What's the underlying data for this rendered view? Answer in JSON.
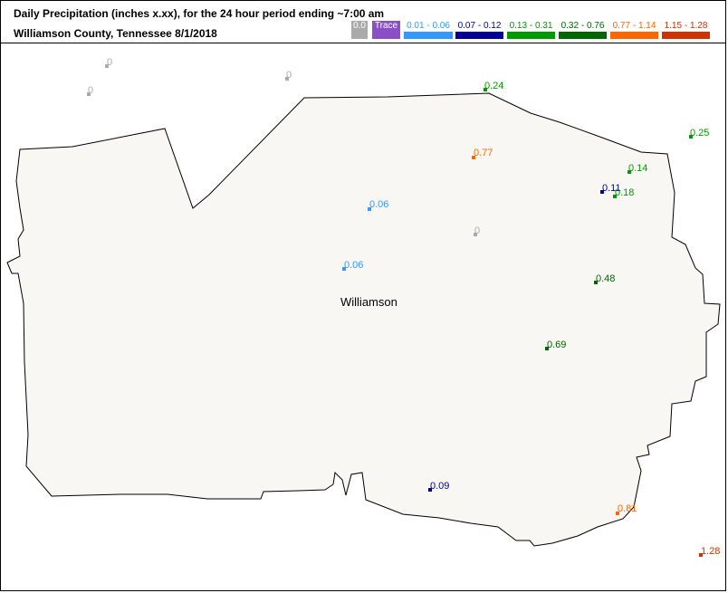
{
  "header": {
    "title": "Daily Precipitation (inches  x.xx),  for the 24 hour period ending ~7:00 am",
    "subtitle": "Williamson County, Tennessee  8/1/2018"
  },
  "legend": [
    {
      "label": "0.0",
      "color": "#aaaaaa"
    },
    {
      "label": "Trace",
      "color": "#8a4fc7"
    },
    {
      "label": "0.01 - 0.06",
      "color": "#3399ff"
    },
    {
      "label": "0.07 - 0.12",
      "color": "#000099"
    },
    {
      "label": "0.13 - 0.31",
      "color": "#009900"
    },
    {
      "label": "0.32 - 0.76",
      "color": "#006600"
    },
    {
      "label": "0.77 - 1.14",
      "color": "#ff6600"
    },
    {
      "label": "1.15 - 1.28",
      "color": "#cc3300"
    }
  ],
  "map": {
    "county_name": "Williamson",
    "fill_color": "#f8f7f3",
    "stations": [
      {
        "value": "0",
        "color": "#aaaaaa"
      },
      {
        "value": "0",
        "color": "#aaaaaa"
      },
      {
        "value": "0",
        "color": "#aaaaaa"
      },
      {
        "value": "0.24",
        "color": "#009900"
      },
      {
        "value": "0.25",
        "color": "#009900"
      },
      {
        "value": "0.77",
        "color": "#ff6600"
      },
      {
        "value": "0.14",
        "color": "#009900"
      },
      {
        "value": "0.11",
        "color": "#000099"
      },
      {
        "value": "0.18",
        "color": "#009900"
      },
      {
        "value": "0.06",
        "color": "#3399ff"
      },
      {
        "value": "0",
        "color": "#aaaaaa"
      },
      {
        "value": "0.06",
        "color": "#3399ff"
      },
      {
        "value": "0.48",
        "color": "#006600"
      },
      {
        "value": "0.69",
        "color": "#006600"
      },
      {
        "value": "0.09",
        "color": "#000099"
      },
      {
        "value": "0.81",
        "color": "#ff6600"
      },
      {
        "value": "1.28",
        "color": "#cc3300"
      }
    ]
  }
}
